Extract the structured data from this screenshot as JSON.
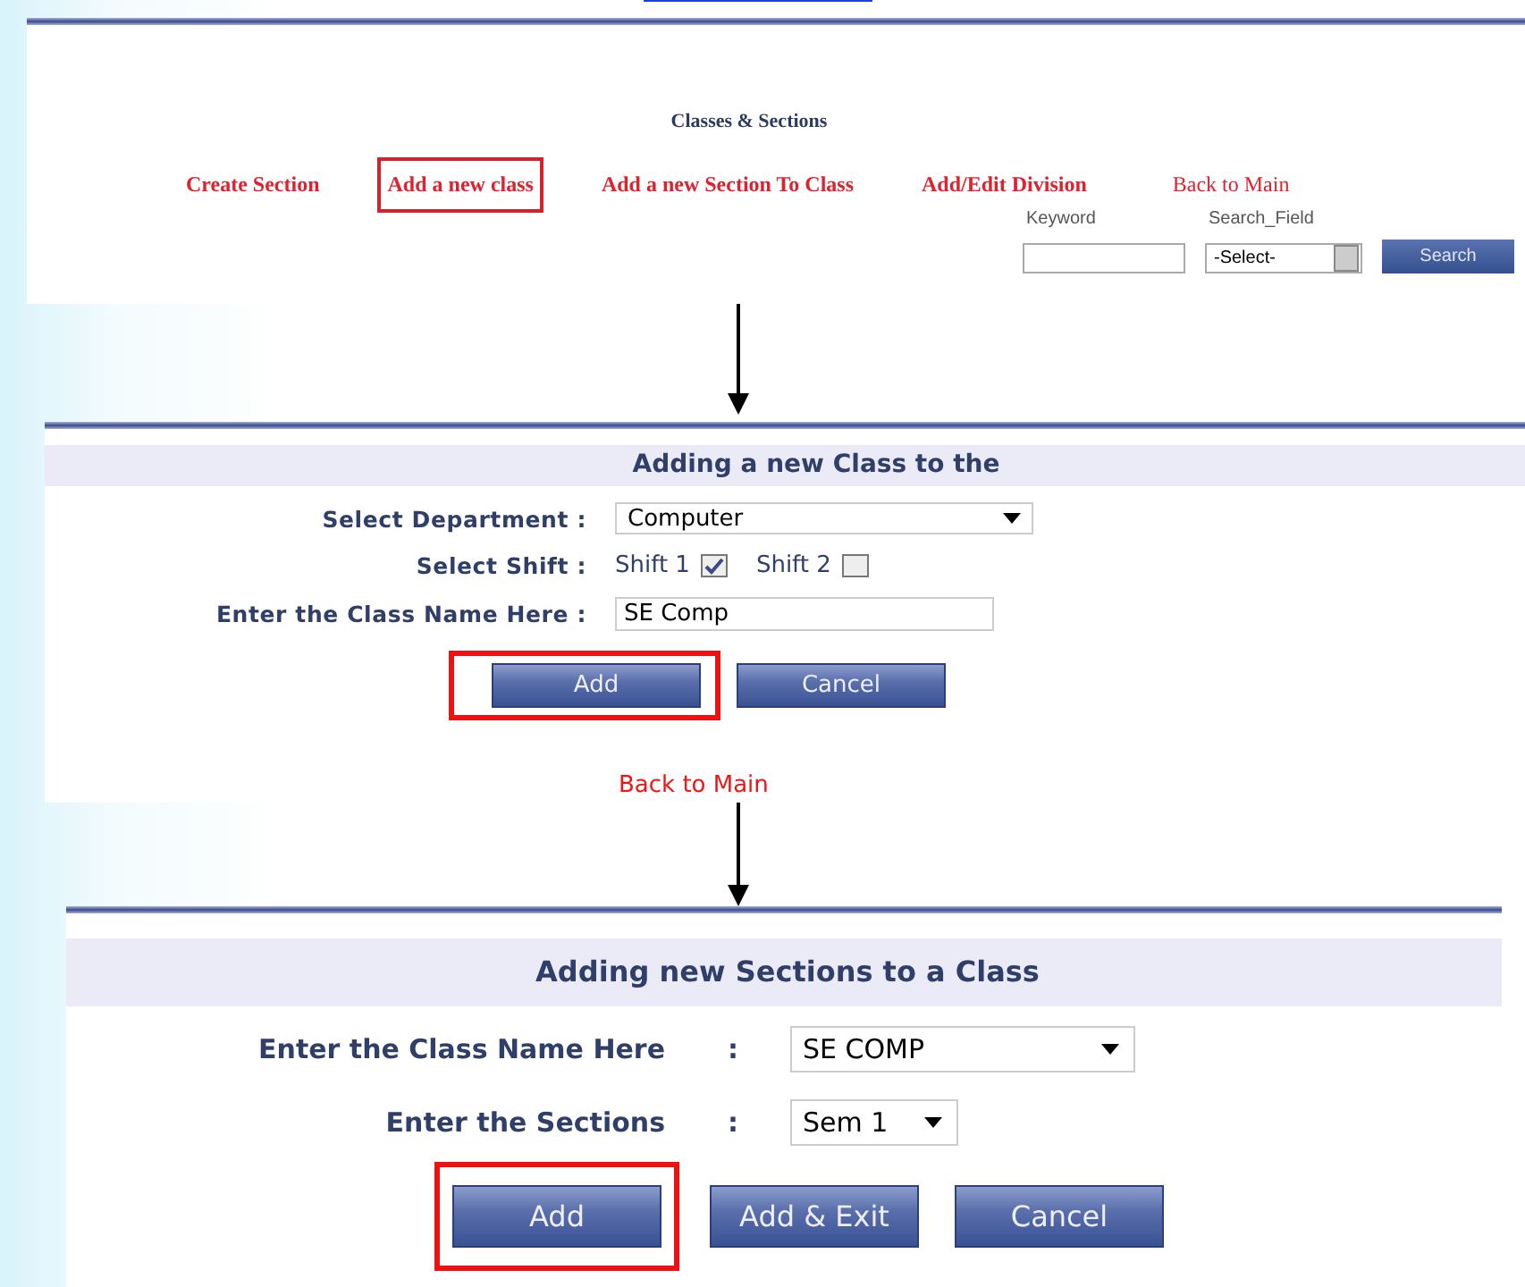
{
  "top_panel": {
    "title": "Classes & Sections",
    "nav_links": [
      {
        "label": "Create Section",
        "highlighted": false,
        "kind": "bold"
      },
      {
        "label": "Add a new class",
        "highlighted": true,
        "kind": "bold"
      },
      {
        "label": "Add a new Section To Class",
        "highlighted": false,
        "kind": "bold"
      },
      {
        "label": "Add/Edit Division",
        "highlighted": false,
        "kind": "bold"
      },
      {
        "label": "Back to Main",
        "highlighted": false,
        "kind": "plain"
      }
    ],
    "search": {
      "keyword_label": "Keyword",
      "field_label": "Search_Field",
      "field_value": "-Select-",
      "button": "Search"
    }
  },
  "class_panel": {
    "title": "Adding a new Class to the",
    "department_label": "Select Department :",
    "department_value": "Computer",
    "shift_label": "Select Shift :",
    "shifts": [
      {
        "label": "Shift 1",
        "checked": true
      },
      {
        "label": "Shift 2",
        "checked": false
      }
    ],
    "class_name_label": "Enter the Class Name Here :",
    "class_name_value": "SE Comp",
    "buttons": [
      {
        "label": "Add",
        "highlighted": true
      },
      {
        "label": "Cancel",
        "highlighted": false
      }
    ],
    "back_link": "Back to Main"
  },
  "sections_panel": {
    "title": "Adding new Sections to a Class",
    "rows": [
      {
        "label": "Enter the Class Name Here",
        "colon": ":",
        "value": "SE COMP",
        "kind": "wide"
      },
      {
        "label": "Enter the Sections",
        "colon": ":",
        "value": "Sem 1",
        "kind": "narrow"
      }
    ],
    "buttons": [
      {
        "label": "Add",
        "highlighted": true
      },
      {
        "label": "Add & Exit",
        "highlighted": false
      },
      {
        "label": "Cancel",
        "highlighted": false
      }
    ]
  }
}
